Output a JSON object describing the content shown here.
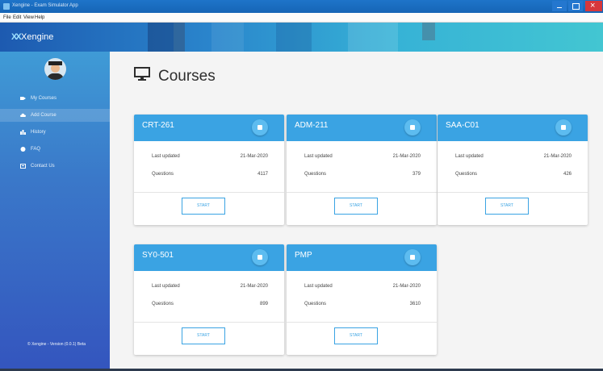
{
  "window": {
    "title": "Xengine - Exam Simulator App"
  },
  "menu": [
    "File",
    "Edit",
    "View",
    "Help"
  ],
  "header": {
    "logo_text": "Xengine"
  },
  "sidebar": {
    "items": [
      {
        "label": "My Courses",
        "icon": "tag-icon",
        "active": false
      },
      {
        "label": "Add Course",
        "icon": "cloud-upload-icon",
        "active": true
      },
      {
        "label": "History",
        "icon": "bar-chart-icon",
        "active": false
      },
      {
        "label": "FAQ",
        "icon": "question-icon",
        "active": false
      },
      {
        "label": "Contact Us",
        "icon": "contact-card-icon",
        "active": false
      }
    ],
    "footer": "© Xengine - Version (0.0.1) Beta"
  },
  "main": {
    "title": "Courses",
    "title_icon": "monitor-icon"
  },
  "labels": {
    "last_updated": "Last updated",
    "questions": "Questions",
    "start": "START"
  },
  "courses": [
    {
      "code": "CRT-261",
      "last_updated": "21-Mar-2020",
      "questions": "4117"
    },
    {
      "code": "ADM-211",
      "last_updated": "21-Mar-2020",
      "questions": "379"
    },
    {
      "code": "SAA-C01",
      "last_updated": "21-Mar-2020",
      "questions": "426"
    },
    {
      "code": "SY0-501",
      "last_updated": "21-Mar-2020",
      "questions": "899"
    },
    {
      "code": "PMP",
      "last_updated": "21-Mar-2020",
      "questions": "3610"
    }
  ],
  "colors": {
    "accent": "#3aa3e3",
    "sidebar_top": "#3f9bd6",
    "sidebar_bottom": "#3455be",
    "close_button": "#d6373b"
  }
}
